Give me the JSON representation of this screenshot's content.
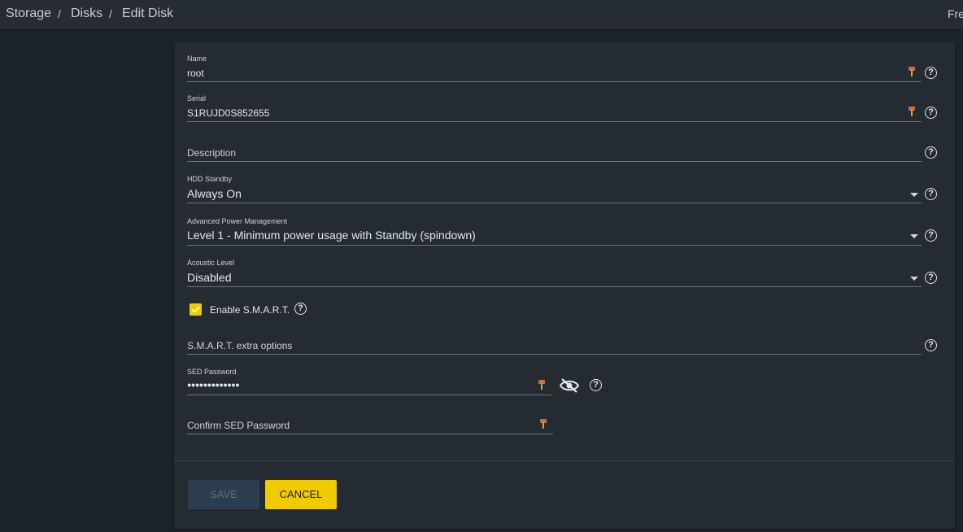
{
  "breadcrumb": {
    "items": [
      "Storage",
      "Disks",
      "Edit Disk"
    ],
    "separator": "/"
  },
  "topbar": {
    "right_text": "Fre"
  },
  "form": {
    "name": {
      "label": "Name",
      "value": "root"
    },
    "serial": {
      "label": "Serial",
      "value": "S1RUJD0S852655"
    },
    "description": {
      "placeholder": "Description"
    },
    "hdd_standby": {
      "label": "HDD Standby",
      "value": "Always On"
    },
    "apm": {
      "label": "Advanced Power Management",
      "value": "Level 1 - Minimum power usage with Standby (spindown)"
    },
    "acoustic": {
      "label": "Acoustic Level",
      "value": "Disabled"
    },
    "enable_smart": {
      "label": "Enable S.M.A.R.T.",
      "checked": true
    },
    "smart_extra": {
      "placeholder": "S.M.A.R.T. extra options"
    },
    "sed_password": {
      "label": "SED Password",
      "value": "●●●●●●●●●●●●●"
    },
    "confirm_sed": {
      "placeholder": "Confirm SED Password"
    }
  },
  "buttons": {
    "save": "SAVE",
    "cancel": "CANCEL"
  },
  "help_glyph": "?",
  "icons": {
    "help": "help-circle-icon",
    "key": "key-icon",
    "dropdown": "chevron-down-icon",
    "visibility": "visibility-off-icon",
    "check": "check-icon"
  },
  "colors": {
    "background": "#1d232b",
    "card": "#242b33",
    "accent": "#f0cb00",
    "save_button": "#2b3e4e",
    "save_text": "#5e7080"
  }
}
